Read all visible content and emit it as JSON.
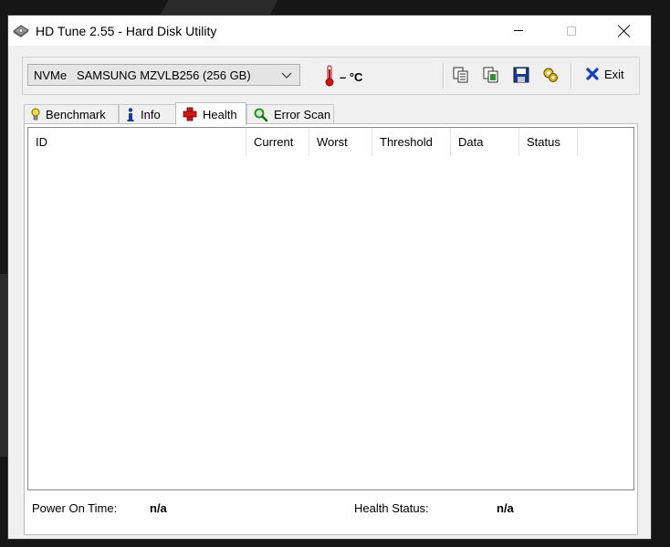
{
  "window": {
    "title": "HD Tune 2.55 - Hard Disk Utility"
  },
  "toolbar": {
    "drive": "NVMe   SAMSUNG MZVLB256 (256 GB)",
    "temperature": "– °C",
    "exit_label": "Exit",
    "icons": [
      "copy-info-icon",
      "copy-screenshot-icon",
      "save-icon",
      "options-icon"
    ]
  },
  "tabs": [
    {
      "label": "Benchmark",
      "icon": "lightbulb-icon"
    },
    {
      "label": "Info",
      "icon": "info-icon"
    },
    {
      "label": "Health",
      "icon": "health-cross-icon",
      "active": true
    },
    {
      "label": "Error Scan",
      "icon": "magnifier-icon"
    }
  ],
  "health_table": {
    "columns": [
      "ID",
      "Current",
      "Worst",
      "Threshold",
      "Data",
      "Status"
    ],
    "rows": []
  },
  "footer": {
    "power_on_label": "Power On Time:",
    "power_on_value": "n/a",
    "health_status_label": "Health Status:",
    "health_status_value": "n/a"
  },
  "colors": {
    "temp_red": "#d01010",
    "health_red": "#d01818",
    "exit_blue": "#1040c0"
  }
}
